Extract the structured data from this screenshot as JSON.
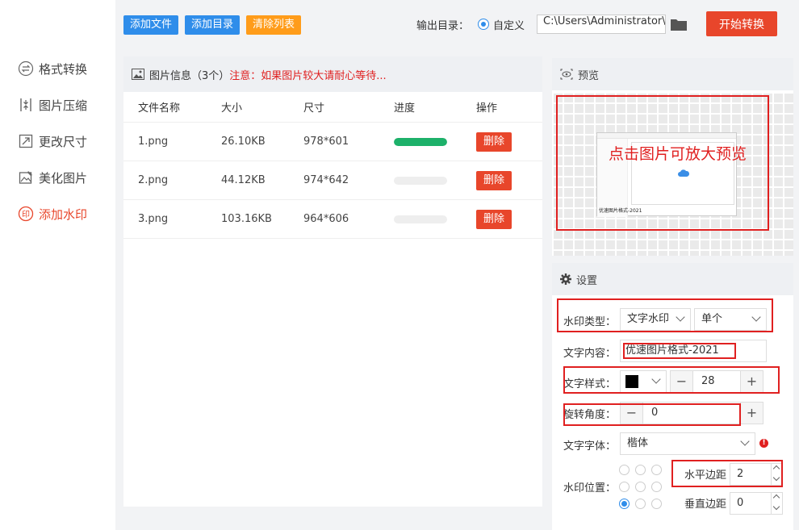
{
  "sidebar": {
    "items": [
      {
        "label": "格式转换",
        "icon": "format-convert-icon",
        "active": false
      },
      {
        "label": "图片压缩",
        "icon": "compress-icon",
        "active": false
      },
      {
        "label": "更改尺寸",
        "icon": "resize-icon",
        "active": false
      },
      {
        "label": "美化图片",
        "icon": "beautify-icon",
        "active": false
      },
      {
        "label": "添加水印",
        "icon": "watermark-icon",
        "active": true
      }
    ]
  },
  "toolbar": {
    "add_file": "添加文件",
    "add_dir": "添加目录",
    "clear_list": "清除列表",
    "output_label": "输出目录：",
    "custom_label": "自定义",
    "output_path": "C:\\Users\\Administrator\\",
    "start": "开始转换"
  },
  "file_panel": {
    "title": "图片信息（3个）",
    "note": "注意：如果图片较大请耐心等待...",
    "columns": {
      "name": "文件名称",
      "size": "大小",
      "dims": "尺寸",
      "progress": "进度",
      "action": "操作"
    },
    "rows": [
      {
        "name": "1.png",
        "size": "26.10KB",
        "dims": "978*601",
        "progress": 1.0,
        "delete": "删除"
      },
      {
        "name": "2.png",
        "size": "44.12KB",
        "dims": "974*642",
        "progress": 0.0,
        "delete": "删除"
      },
      {
        "name": "3.png",
        "size": "103.16KB",
        "dims": "964*606",
        "progress": 0.0,
        "delete": "删除"
      }
    ]
  },
  "preview": {
    "title": "预览",
    "hint": "点击图片可放大预览",
    "watermark_sample": "优速图片格式-2021"
  },
  "settings": {
    "title": "设置",
    "type_label": "水印类型：",
    "type_value": "文字水印",
    "mode_value": "单个",
    "content_label": "文字内容：",
    "content_value": "优速图片格式-2021",
    "style_label": "文字样式：",
    "font_size": "28",
    "text_color": "#000000",
    "angle_label": "旋转角度：",
    "angle_value": "0",
    "font_label": "文字字体：",
    "font_value": "楷体",
    "position_label": "水印位置：",
    "position_selected": "bottom-left",
    "h_margin_label": "水平边距",
    "h_margin_value": "2",
    "v_margin_label": "垂直边距",
    "v_margin_value": "0"
  },
  "colors": {
    "accent_red": "#e8462b",
    "accent_blue": "#2f8dea",
    "accent_orange": "#ff9c1a",
    "progress_green": "#1db16a",
    "annotation_red": "#e02020"
  }
}
